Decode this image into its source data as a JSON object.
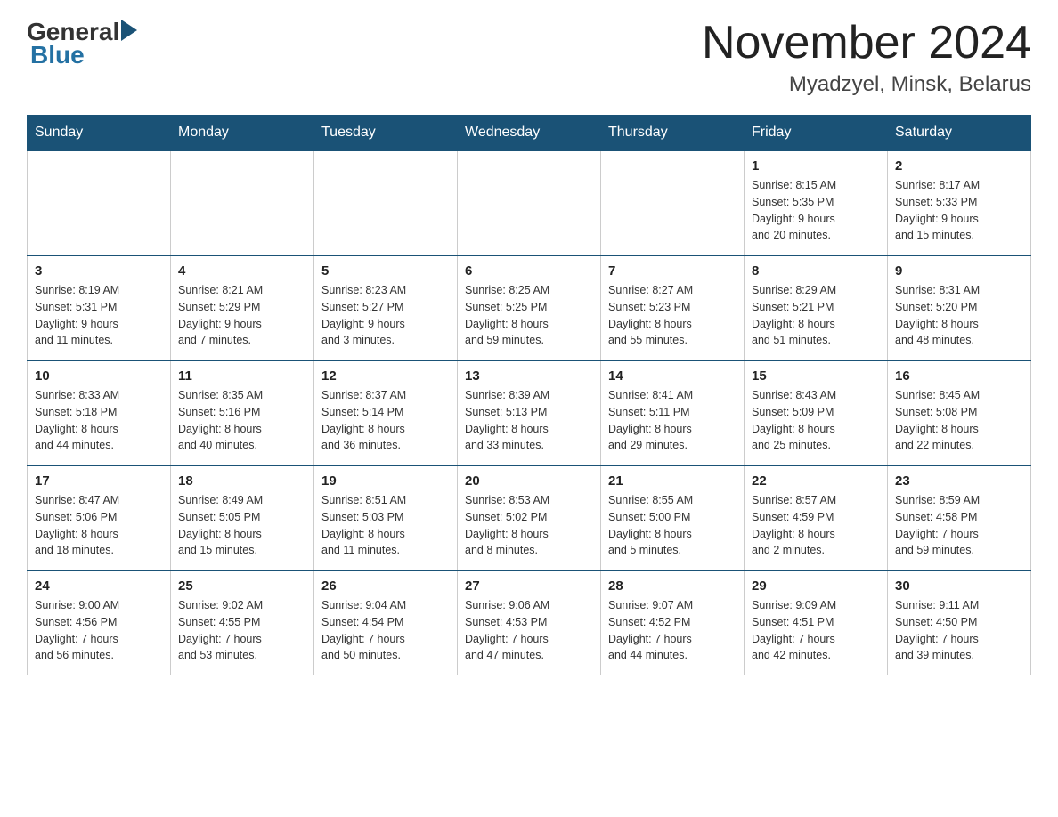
{
  "header": {
    "logo_general": "General",
    "logo_blue": "Blue",
    "title": "November 2024",
    "subtitle": "Myadzyel, Minsk, Belarus"
  },
  "calendar": {
    "days_of_week": [
      "Sunday",
      "Monday",
      "Tuesday",
      "Wednesday",
      "Thursday",
      "Friday",
      "Saturday"
    ],
    "weeks": [
      [
        {
          "day": "",
          "info": ""
        },
        {
          "day": "",
          "info": ""
        },
        {
          "day": "",
          "info": ""
        },
        {
          "day": "",
          "info": ""
        },
        {
          "day": "",
          "info": ""
        },
        {
          "day": "1",
          "info": "Sunrise: 8:15 AM\nSunset: 5:35 PM\nDaylight: 9 hours\nand 20 minutes."
        },
        {
          "day": "2",
          "info": "Sunrise: 8:17 AM\nSunset: 5:33 PM\nDaylight: 9 hours\nand 15 minutes."
        }
      ],
      [
        {
          "day": "3",
          "info": "Sunrise: 8:19 AM\nSunset: 5:31 PM\nDaylight: 9 hours\nand 11 minutes."
        },
        {
          "day": "4",
          "info": "Sunrise: 8:21 AM\nSunset: 5:29 PM\nDaylight: 9 hours\nand 7 minutes."
        },
        {
          "day": "5",
          "info": "Sunrise: 8:23 AM\nSunset: 5:27 PM\nDaylight: 9 hours\nand 3 minutes."
        },
        {
          "day": "6",
          "info": "Sunrise: 8:25 AM\nSunset: 5:25 PM\nDaylight: 8 hours\nand 59 minutes."
        },
        {
          "day": "7",
          "info": "Sunrise: 8:27 AM\nSunset: 5:23 PM\nDaylight: 8 hours\nand 55 minutes."
        },
        {
          "day": "8",
          "info": "Sunrise: 8:29 AM\nSunset: 5:21 PM\nDaylight: 8 hours\nand 51 minutes."
        },
        {
          "day": "9",
          "info": "Sunrise: 8:31 AM\nSunset: 5:20 PM\nDaylight: 8 hours\nand 48 minutes."
        }
      ],
      [
        {
          "day": "10",
          "info": "Sunrise: 8:33 AM\nSunset: 5:18 PM\nDaylight: 8 hours\nand 44 minutes."
        },
        {
          "day": "11",
          "info": "Sunrise: 8:35 AM\nSunset: 5:16 PM\nDaylight: 8 hours\nand 40 minutes."
        },
        {
          "day": "12",
          "info": "Sunrise: 8:37 AM\nSunset: 5:14 PM\nDaylight: 8 hours\nand 36 minutes."
        },
        {
          "day": "13",
          "info": "Sunrise: 8:39 AM\nSunset: 5:13 PM\nDaylight: 8 hours\nand 33 minutes."
        },
        {
          "day": "14",
          "info": "Sunrise: 8:41 AM\nSunset: 5:11 PM\nDaylight: 8 hours\nand 29 minutes."
        },
        {
          "day": "15",
          "info": "Sunrise: 8:43 AM\nSunset: 5:09 PM\nDaylight: 8 hours\nand 25 minutes."
        },
        {
          "day": "16",
          "info": "Sunrise: 8:45 AM\nSunset: 5:08 PM\nDaylight: 8 hours\nand 22 minutes."
        }
      ],
      [
        {
          "day": "17",
          "info": "Sunrise: 8:47 AM\nSunset: 5:06 PM\nDaylight: 8 hours\nand 18 minutes."
        },
        {
          "day": "18",
          "info": "Sunrise: 8:49 AM\nSunset: 5:05 PM\nDaylight: 8 hours\nand 15 minutes."
        },
        {
          "day": "19",
          "info": "Sunrise: 8:51 AM\nSunset: 5:03 PM\nDaylight: 8 hours\nand 11 minutes."
        },
        {
          "day": "20",
          "info": "Sunrise: 8:53 AM\nSunset: 5:02 PM\nDaylight: 8 hours\nand 8 minutes."
        },
        {
          "day": "21",
          "info": "Sunrise: 8:55 AM\nSunset: 5:00 PM\nDaylight: 8 hours\nand 5 minutes."
        },
        {
          "day": "22",
          "info": "Sunrise: 8:57 AM\nSunset: 4:59 PM\nDaylight: 8 hours\nand 2 minutes."
        },
        {
          "day": "23",
          "info": "Sunrise: 8:59 AM\nSunset: 4:58 PM\nDaylight: 7 hours\nand 59 minutes."
        }
      ],
      [
        {
          "day": "24",
          "info": "Sunrise: 9:00 AM\nSunset: 4:56 PM\nDaylight: 7 hours\nand 56 minutes."
        },
        {
          "day": "25",
          "info": "Sunrise: 9:02 AM\nSunset: 4:55 PM\nDaylight: 7 hours\nand 53 minutes."
        },
        {
          "day": "26",
          "info": "Sunrise: 9:04 AM\nSunset: 4:54 PM\nDaylight: 7 hours\nand 50 minutes."
        },
        {
          "day": "27",
          "info": "Sunrise: 9:06 AM\nSunset: 4:53 PM\nDaylight: 7 hours\nand 47 minutes."
        },
        {
          "day": "28",
          "info": "Sunrise: 9:07 AM\nSunset: 4:52 PM\nDaylight: 7 hours\nand 44 minutes."
        },
        {
          "day": "29",
          "info": "Sunrise: 9:09 AM\nSunset: 4:51 PM\nDaylight: 7 hours\nand 42 minutes."
        },
        {
          "day": "30",
          "info": "Sunrise: 9:11 AM\nSunset: 4:50 PM\nDaylight: 7 hours\nand 39 minutes."
        }
      ]
    ]
  }
}
